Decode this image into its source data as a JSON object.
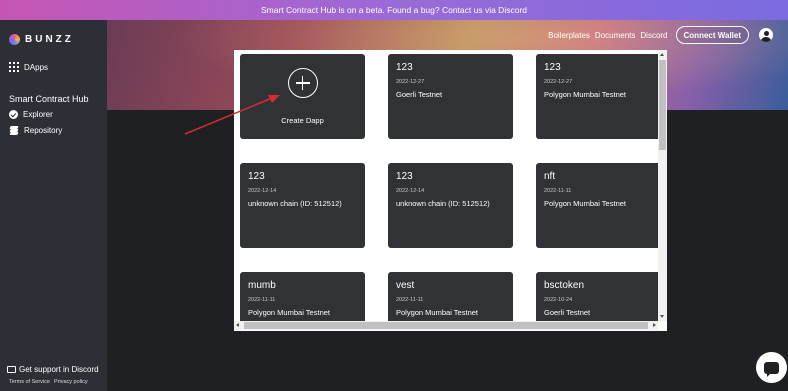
{
  "banner": {
    "text": "Smart Contract Hub is on a beta. Found a bug? Contact us via Discord"
  },
  "brand": {
    "name": "BUNZZ"
  },
  "sidebar": {
    "dapps_label": "DApps",
    "section_title": "Smart Contract Hub",
    "items": [
      {
        "label": "Explorer",
        "icon": "check-circle-icon"
      },
      {
        "label": "Repository",
        "icon": "layers-icon"
      }
    ],
    "support_label": "Get support in Discord",
    "terms_label": "Terms of Service",
    "privacy_label": "Privacy policy"
  },
  "topnav": {
    "links": [
      "Boilerplates",
      "Documents",
      "Discord"
    ],
    "connect_label": "Connect Wallet"
  },
  "create_card": {
    "label": "Create Dapp"
  },
  "dapps": [
    {
      "title": "123",
      "date": "2022-12-27",
      "network": "Goerli Testnet"
    },
    {
      "title": "123",
      "date": "2022-12-27",
      "network": "Polygon Mumbai Testnet"
    },
    {
      "title": "123",
      "date": "2022-12-14",
      "network": "unknown chain (ID: 512512)"
    },
    {
      "title": "123",
      "date": "2022-12-14",
      "network": "unknown chain (ID: 512512)"
    },
    {
      "title": "nft",
      "date": "2022-11-11",
      "network": "Polygon Mumbai Testnet"
    },
    {
      "title": "mumb",
      "date": "2022-11-11",
      "network": "Polygon Mumbai Testnet"
    },
    {
      "title": "vest",
      "date": "2022-11-11",
      "network": "Polygon Mumbai Testnet"
    },
    {
      "title": "bsctoken",
      "date": "2022-10-24",
      "network": "Goerli Testnet"
    }
  ],
  "colors": {
    "annotation_arrow": "#d32f2f",
    "card_bg": "#303236",
    "sidebar_bg": "#2c2f35"
  }
}
